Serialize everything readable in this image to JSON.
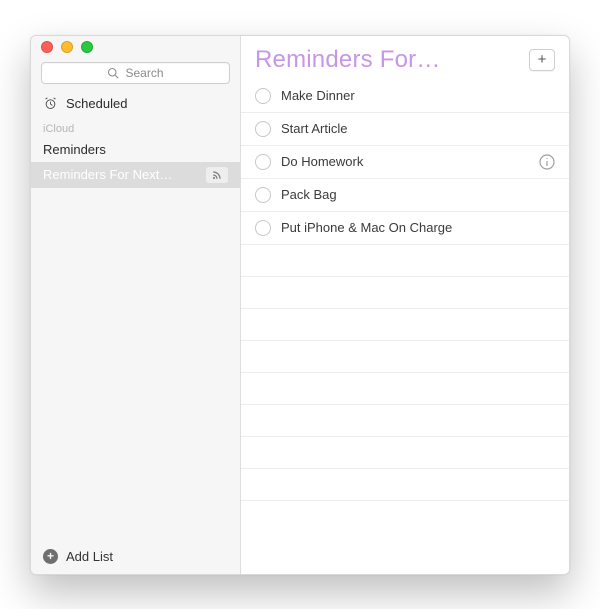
{
  "search": {
    "placeholder": "Search"
  },
  "sidebar": {
    "scheduled_label": "Scheduled",
    "section_label": "iCloud",
    "lists": [
      {
        "label": "Reminders",
        "selected": false
      },
      {
        "label": "Reminders For Next…",
        "selected": true,
        "shared": true
      }
    ],
    "add_label": "Add List"
  },
  "main": {
    "title": "Reminders For…",
    "add_symbol": "+",
    "items": [
      {
        "text": "Make Dinner",
        "done": false
      },
      {
        "text": "Start Article",
        "done": false
      },
      {
        "text": "Do Homework",
        "done": false,
        "info": true
      },
      {
        "text": "Pack Bag",
        "done": false
      },
      {
        "text": "Put iPhone & Mac On Charge",
        "done": false
      }
    ]
  }
}
